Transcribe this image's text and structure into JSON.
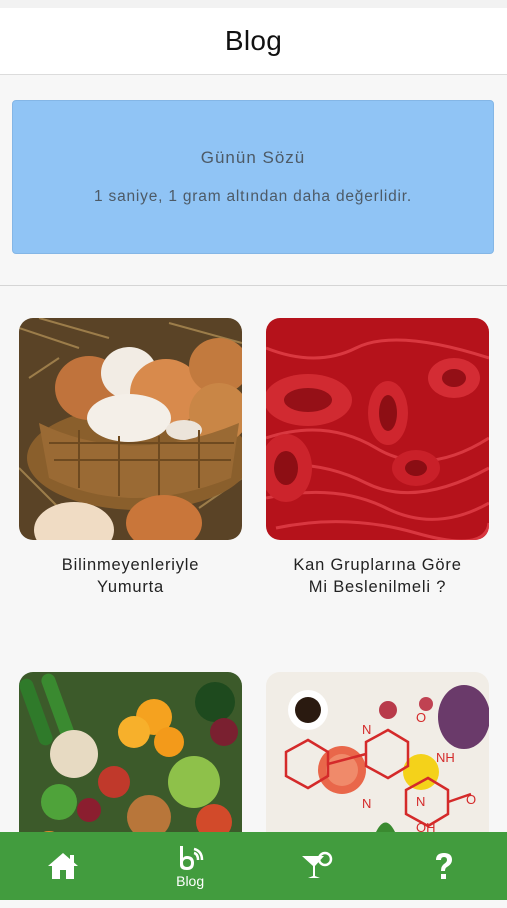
{
  "header": {
    "title": "Blog"
  },
  "quote": {
    "title": "Günün Sözü",
    "text": "1 saniye, 1 gram altından daha değerlidir."
  },
  "articles": [
    {
      "title": "Bilinmeyenleriyle\nYumurta",
      "image": "eggs-in-basket-photo"
    },
    {
      "title": "Kan Gruplarına Göre\nMi Beslenilmeli ?",
      "image": "red-blood-cells-photo"
    },
    {
      "title": "",
      "image": "fruits-and-vegetables-photo"
    },
    {
      "title": "",
      "image": "molecule-and-food-photo"
    }
  ],
  "tabbar": {
    "background": "#429c3e",
    "tabs": [
      {
        "icon": "home-icon",
        "label": ""
      },
      {
        "icon": "blog-icon",
        "label": "Blog"
      },
      {
        "icon": "cocktail-icon",
        "label": ""
      },
      {
        "icon": "question-icon",
        "label": ""
      }
    ]
  }
}
